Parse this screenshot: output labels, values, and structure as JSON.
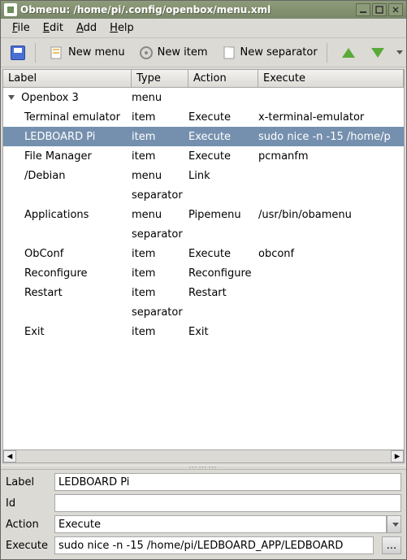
{
  "window": {
    "title": "Obmenu: /home/pi/.config/openbox/menu.xml"
  },
  "menubar": {
    "file": "File",
    "edit": "Edit",
    "add": "Add",
    "help": "Help"
  },
  "toolbar": {
    "new_menu": "New menu",
    "new_item": "New item",
    "new_separator": "New separator"
  },
  "columns": {
    "label": "Label",
    "type": "Type",
    "action": "Action",
    "execute": "Execute"
  },
  "tree": {
    "root": {
      "label": "Openbox 3",
      "type": "menu",
      "action": "",
      "execute": ""
    },
    "rows": [
      {
        "label": "Terminal emulator",
        "type": "item",
        "action": "Execute",
        "execute": "x-terminal-emulator"
      },
      {
        "label": "LEDBOARD Pi",
        "type": "item",
        "action": "Execute",
        "execute": "sudo nice -n -15 /home/p",
        "selected": true
      },
      {
        "label": "File Manager",
        "type": "item",
        "action": "Execute",
        "execute": "pcmanfm"
      },
      {
        "label": "/Debian",
        "type": "menu",
        "action": "Link",
        "execute": ""
      },
      {
        "label": "",
        "type": "separator",
        "action": "",
        "execute": ""
      },
      {
        "label": "Applications",
        "type": "menu",
        "action": "Pipemenu",
        "execute": "/usr/bin/obamenu"
      },
      {
        "label": "",
        "type": "separator",
        "action": "",
        "execute": ""
      },
      {
        "label": "ObConf",
        "type": "item",
        "action": "Execute",
        "execute": "obconf"
      },
      {
        "label": "Reconfigure",
        "type": "item",
        "action": "Reconfigure",
        "execute": ""
      },
      {
        "label": "Restart",
        "type": "item",
        "action": "Restart",
        "execute": ""
      },
      {
        "label": "",
        "type": "separator",
        "action": "",
        "execute": ""
      },
      {
        "label": "Exit",
        "type": "item",
        "action": "Exit",
        "execute": ""
      }
    ]
  },
  "form": {
    "label_caption": "Label",
    "id_caption": "Id",
    "action_caption": "Action",
    "execute_caption": "Execute",
    "label_value": "LEDBOARD Pi",
    "id_value": "",
    "action_value": "Execute",
    "execute_value": "sudo nice -n -15 /home/pi/LEDBOARD_APP/LEDBOARD",
    "more": "..."
  }
}
